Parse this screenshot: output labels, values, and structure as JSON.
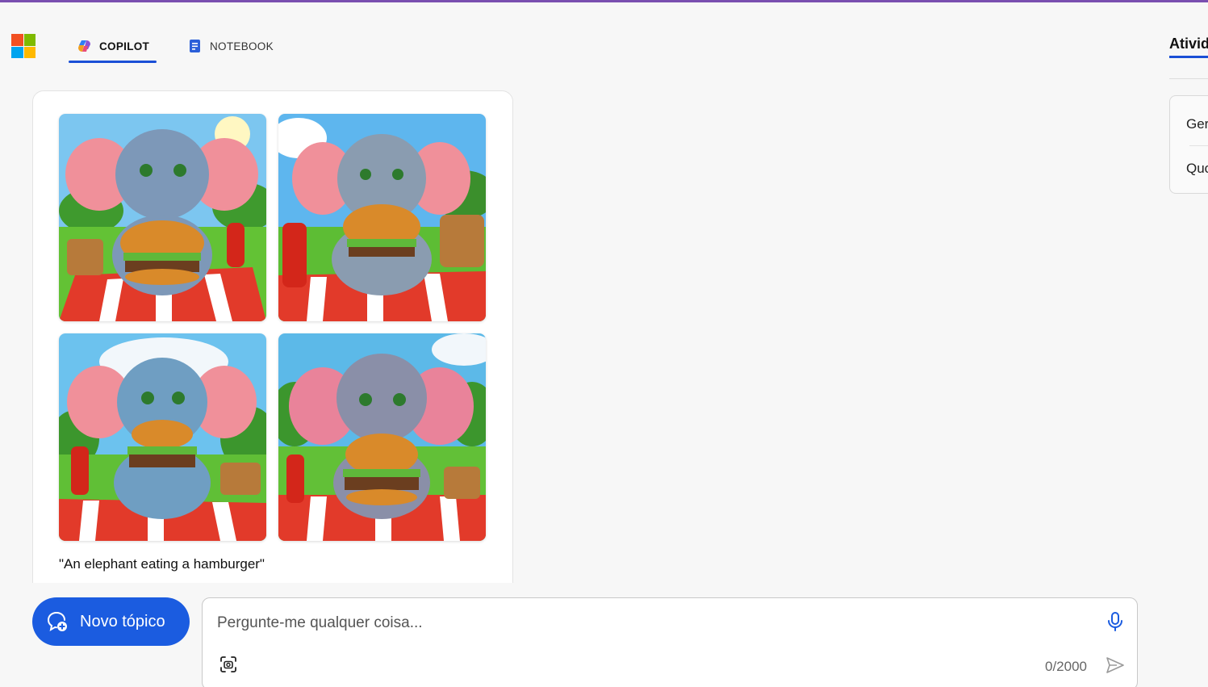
{
  "header": {
    "tabs": [
      {
        "label": "COPILOT",
        "active": true
      },
      {
        "label": "NOTEBOOK",
        "active": false
      }
    ],
    "accent_color": "#7a4fb0",
    "tab_underline_color": "#1a4fd6"
  },
  "side_panel": {
    "title": "Ativid",
    "items": [
      "Ger",
      "Quo"
    ]
  },
  "result_card": {
    "images": [
      {
        "icon": "elephant-image-1"
      },
      {
        "icon": "elephant-image-2"
      },
      {
        "icon": "elephant-image-3"
      },
      {
        "icon": "elephant-image-4"
      }
    ],
    "caption": "\"An elephant eating a hamburger\""
  },
  "composer": {
    "new_topic_label": "Novo tópico",
    "placeholder": "Pergunte-me qualquer coisa...",
    "char_count": "0/2000",
    "button_color": "#1b5ce0"
  }
}
